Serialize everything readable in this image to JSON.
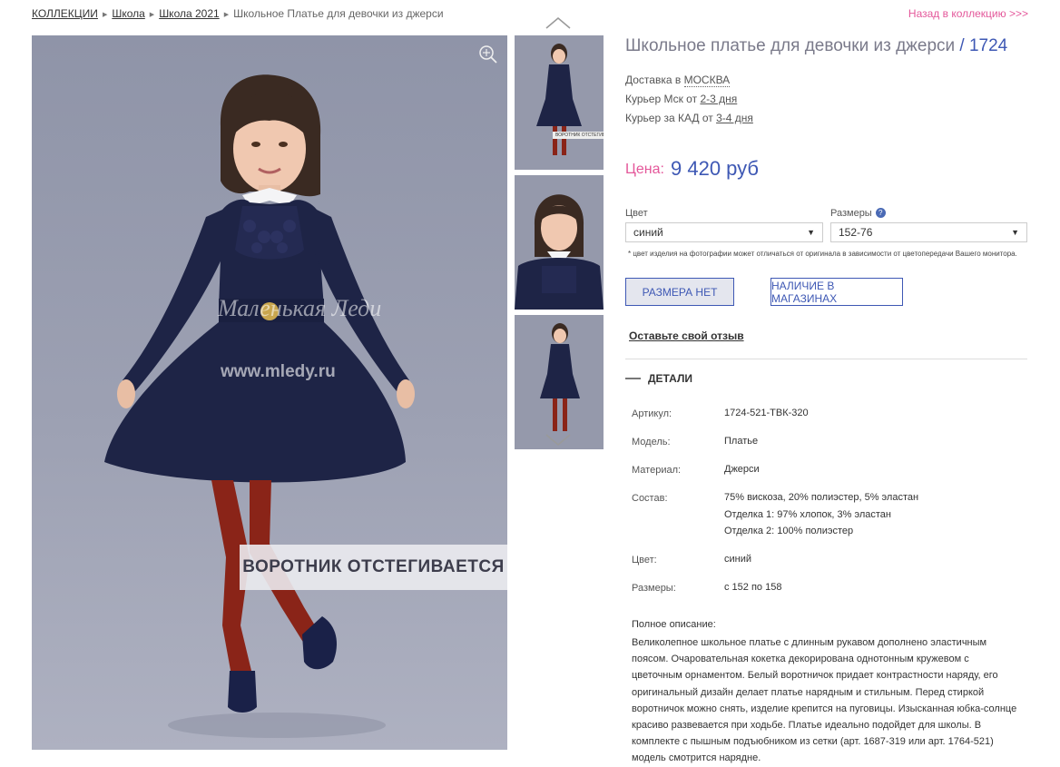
{
  "breadcrumb": {
    "items": [
      "КОЛЛЕКЦИИ",
      "Школа",
      "Школа 2021"
    ],
    "current": "Школьное Платье для девочки из джерси"
  },
  "back_link": "Назад в коллекцию >>>",
  "gallery": {
    "callout": "ВОРОТНИК ОТСТЕГИВАЕТСЯ",
    "watermark_brand": "Маленькая Леди",
    "watermark_url": "www.mledy.ru",
    "thumb_label": "ВОРОТНИК ОТСТЕГИВАЕТСЯ"
  },
  "product": {
    "title": "Школьное платье для девочки из джерси",
    "article_sep": "/",
    "article": "1724",
    "delivery": {
      "city_prefix": "Доставка в",
      "city": "МОСКВА",
      "courier1_prefix": "Курьер Мск от",
      "courier1_days": "2-3 дня",
      "courier2_prefix": "Курьер за КАД от",
      "courier2_days": "3-4 дня"
    },
    "price_label": "Цена:",
    "price": "9 420 руб",
    "color_label": "Цвет",
    "color_value": "синий",
    "size_label": "Размеры",
    "size_help": "?",
    "size_value": "152-76",
    "color_note": "* цвет изделия на фотографии может отличаться от оригинала в зависимости от цветопередачи Вашего монитора.",
    "no_size_button": "РАЗМЕРА НЕТ",
    "in_stores_button": "НАЛИЧИЕ В МАГАЗИНАХ",
    "review_link": "Оставьте свой отзыв",
    "details_title": "ДЕТАЛИ",
    "details": [
      {
        "label": "Артикул:",
        "value": "1724-521-ТВК-320"
      },
      {
        "label": "Модель:",
        "value": "Платье"
      },
      {
        "label": "Материал:",
        "value": "Джерси"
      },
      {
        "label": "Состав:",
        "value": "75% вискоза, 20% полиэстер, 5% эластан",
        "value2": "Отделка 1: 97% хлопок, 3% эластан",
        "value3": "Отделка 2: 100% полиэстер"
      },
      {
        "label": "Цвет:",
        "value": "синий"
      },
      {
        "label": "Размеры:",
        "value": "с 152 по 158"
      }
    ],
    "full_description_title": "Полное описание:",
    "full_description": "Великолепное школьное платье с длинным рукавом дополнено эластичным поясом. Очаровательная кокетка декорирована однотонным кружевом с цветочным орнаментом. Белый воротничок придает контрастности наряду, его оригинальный дизайн делает платье нарядным и стильным. Перед стиркой воротничок можно снять, изделие крепится на пуговицы. Изысканная юбка-солнце красиво развевается при ходьбе. Платье идеально подойдет для школы. В комплекте с пышным подъюбником из сетки (арт. 1687-319 или арт. 1764-521) модель смотрится нарядне."
  },
  "colors": {
    "accent_blue": "#3e58b4",
    "accent_pink": "#e4579a",
    "dress_navy": "#1e2446",
    "tights_red": "#8a2418"
  }
}
